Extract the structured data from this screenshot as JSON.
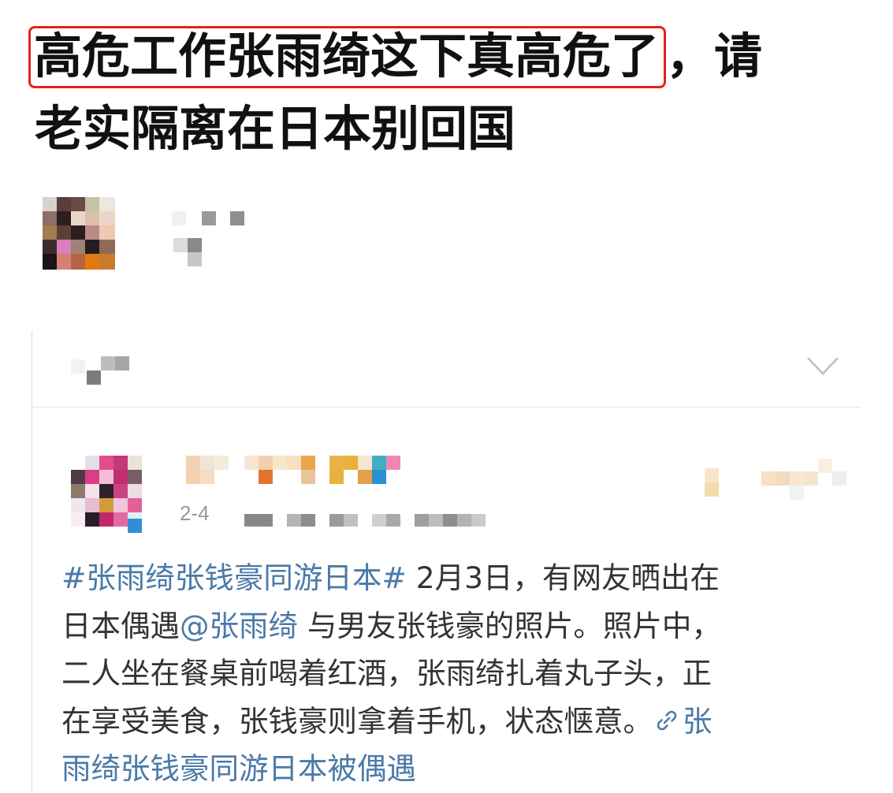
{
  "headline": {
    "boxed": "高危工作张雨绮这下真高危了",
    "rest_line1": "，请",
    "line2": "老实隔离在日本别回国",
    "highlight_color": "#e2231a"
  },
  "post_card": {
    "date": "2-4",
    "expand_icon": "chevron-down-icon",
    "body": {
      "hashtag": "#张雨绮张钱豪同游日本#",
      "text1": " 2月3日，有网友晒出在",
      "text2a": "日本偶遇",
      "mention": "@张雨绮",
      "text2b": " 与男友张钱豪的照片。照片中，",
      "line3": "二人坐在餐桌前喝着红酒，张雨绮扎着丸子头，正",
      "line4": "在享受美食，张钱豪则拿着手机，状态惬意。",
      "link_icon": "link-icon",
      "link_part1": "张",
      "link_part2": "雨绮张钱豪同游日本被偶遇"
    },
    "link_color": "#4a7aa8",
    "text_color": "#333333"
  }
}
